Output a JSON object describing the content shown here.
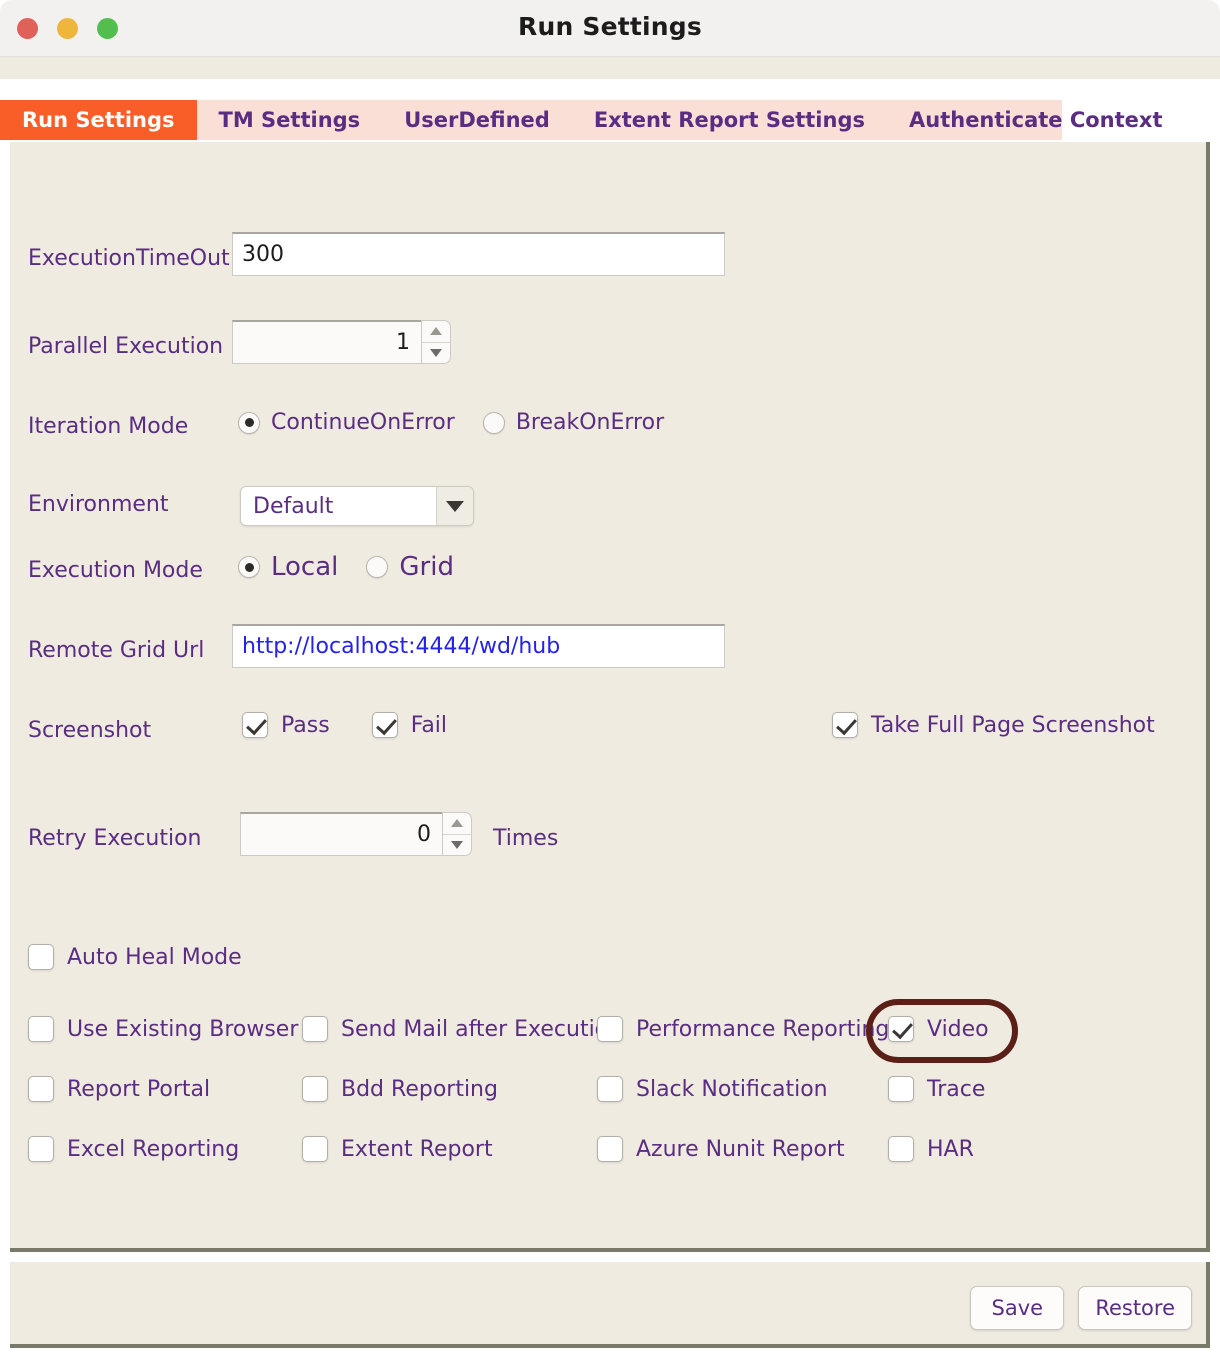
{
  "window": {
    "title": "Run Settings",
    "controls": [
      {
        "name": "close",
        "color": "#e0605a"
      },
      {
        "name": "minimize",
        "color": "#efb63c"
      },
      {
        "name": "maximize",
        "color": "#52be4f"
      }
    ]
  },
  "tabs": [
    {
      "label": "Run Settings",
      "active": true
    },
    {
      "label": "TM Settings",
      "active": false
    },
    {
      "label": "UserDefined",
      "active": false
    },
    {
      "label": "Extent Report Settings",
      "active": false
    },
    {
      "label": "Authenticate Context",
      "active": false
    }
  ],
  "form": {
    "execution_timeout": {
      "label": "ExecutionTimeOut",
      "value": "300"
    },
    "parallel_execution": {
      "label": "Parallel Execution",
      "value": "1"
    },
    "iteration_mode": {
      "label": "Iteration Mode",
      "options": [
        {
          "label": "ContinueOnError",
          "selected": true
        },
        {
          "label": "BreakOnError",
          "selected": false
        }
      ]
    },
    "environment": {
      "label": "Environment",
      "value": "Default",
      "options": [
        "Default"
      ]
    },
    "execution_mode": {
      "label": "Execution Mode",
      "options": [
        {
          "label": "Local",
          "selected": true
        },
        {
          "label": "Grid",
          "selected": false
        }
      ]
    },
    "remote_grid_url": {
      "label": "Remote Grid Url",
      "value": "http://localhost:4444/wd/hub"
    },
    "screenshot": {
      "label": "Screenshot",
      "pass": {
        "label": "Pass",
        "checked": true
      },
      "fail": {
        "label": "Fail",
        "checked": true
      },
      "full_page": {
        "label": "Take Full Page Screenshot",
        "checked": true
      }
    },
    "retry_execution": {
      "label": "Retry Execution",
      "value": "0",
      "suffix": "Times"
    },
    "auto_heal_mode": {
      "label": "Auto Heal Mode",
      "checked": false
    }
  },
  "options_grid": {
    "col1": [
      {
        "label": "Use Existing Browser",
        "checked": false
      },
      {
        "label": "Report Portal",
        "checked": false
      },
      {
        "label": "Excel Reporting",
        "checked": false
      }
    ],
    "col2": [
      {
        "label": "Send Mail after Execution",
        "checked": false
      },
      {
        "label": "Bdd Reporting",
        "checked": false
      },
      {
        "label": "Extent Report",
        "checked": false
      }
    ],
    "col3": [
      {
        "label": "Performance Reporting",
        "checked": false
      },
      {
        "label": "Slack Notification",
        "checked": false
      },
      {
        "label": "Azure Nunit Report",
        "checked": false
      }
    ],
    "col4": [
      {
        "label": "Video",
        "checked": true
      },
      {
        "label": "Trace",
        "checked": false
      },
      {
        "label": "HAR",
        "checked": false
      }
    ]
  },
  "annotation": {
    "target": "Video",
    "color": "#5a1f17"
  },
  "footer": {
    "save_label": "Save",
    "restore_label": "Restore"
  },
  "colors": {
    "accent": "#f95e28",
    "tab_strip": "#fadfd6",
    "panel": "#f0ebe0",
    "label_text": "#5a2d82",
    "link_text": "#2422e8"
  }
}
